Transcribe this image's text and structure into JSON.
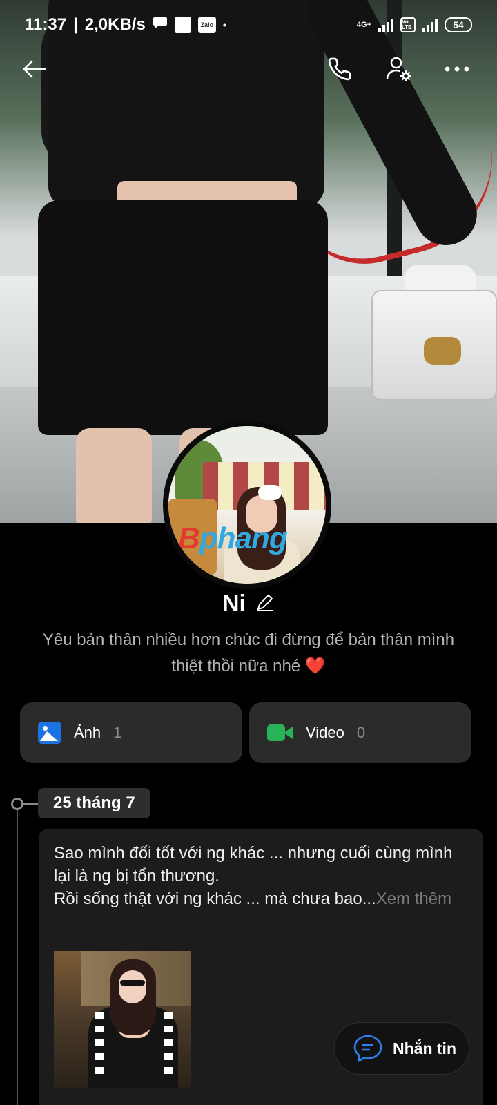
{
  "status_bar": {
    "time": "11:37",
    "separator": "|",
    "speed": "2,0KB/s",
    "zalo_badge": "Zalo",
    "dot": "•",
    "network": "4G+",
    "volte": "Vo LTE",
    "battery": "54"
  },
  "nav": {
    "back_icon": "arrow-left-icon",
    "call_icon": "phone-icon",
    "settings_icon": "user-settings-icon",
    "more_icon": "more-horizontal-icon"
  },
  "profile": {
    "name": "Ni",
    "edit_icon": "pencil-icon",
    "bio": "Yêu bản thân nhiều hơn chúc đi đừng để bản thân mình thiệt thồi nữa nhé",
    "bio_emoji": "❤️",
    "avatar_watermark_a": "B",
    "avatar_watermark_b": "phang"
  },
  "media": {
    "photos": {
      "label": "Ảnh",
      "count": "1",
      "icon": "image-icon",
      "color": "#1b74e4"
    },
    "videos": {
      "label": "Video",
      "count": "0",
      "icon": "video-icon",
      "color": "#28b35a"
    }
  },
  "timeline": {
    "date": "25 tháng 7",
    "post": {
      "text": "Sao mình đối tốt với ng khác ... nhưng cuối cùng mình lại là ng bị tổn thương.\nRồi sống thật với ng khác ... mà chưa bao...",
      "see_more": "Xem thêm"
    }
  },
  "fab": {
    "label": "Nhắn tin",
    "icon": "chat-bubble-icon",
    "color": "#2f80ed"
  }
}
